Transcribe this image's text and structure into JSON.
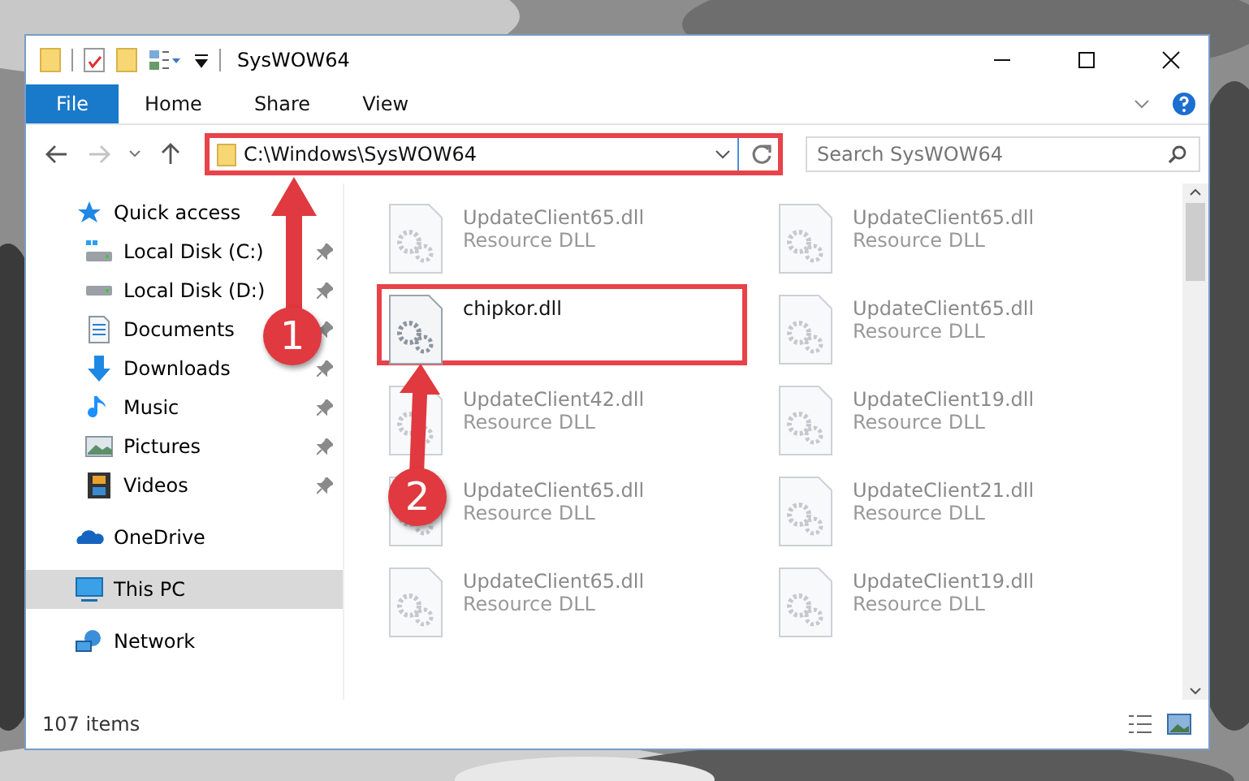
{
  "window": {
    "title": "SysWOW64"
  },
  "ribbon_tabs": [
    {
      "label": "File",
      "kind": "application"
    },
    {
      "label": "Home",
      "kind": "tab"
    },
    {
      "label": "Share",
      "kind": "tab"
    },
    {
      "label": "View",
      "kind": "tab"
    }
  ],
  "address": {
    "path": "C:\\Windows\\SysWOW64",
    "marked": true
  },
  "search": {
    "placeholder": "Search SysWOW64"
  },
  "nav_items": [
    {
      "label": "Quick access",
      "kind": "star",
      "selected": false,
      "children": [
        {
          "label": "Local Disk (C:)",
          "kind": "disk-c",
          "pinned": true,
          "selected": false
        },
        {
          "label": "Local Disk (D:)",
          "kind": "disk",
          "pinned": true,
          "selected": false
        },
        {
          "label": "Documents",
          "kind": "documents",
          "pinned": true,
          "selected": false
        },
        {
          "label": "Downloads",
          "kind": "downloads",
          "pinned": true,
          "selected": false
        },
        {
          "label": "Music",
          "kind": "music",
          "pinned": true,
          "selected": false
        },
        {
          "label": "Pictures",
          "kind": "pictures",
          "pinned": true,
          "selected": false
        },
        {
          "label": "Videos",
          "kind": "videos",
          "pinned": true,
          "selected": false
        }
      ]
    },
    {
      "label": "OneDrive",
      "kind": "cloud",
      "selected": false
    },
    {
      "label": "This PC",
      "kind": "pc",
      "selected": true
    },
    {
      "label": "Network",
      "kind": "network",
      "selected": false
    }
  ],
  "files": [
    {
      "name": "UpdateClient65.dll",
      "type": "Resource DLL",
      "blurred": true,
      "marked": false
    },
    {
      "name": "UpdateClient65.dll",
      "type": "Resource DLL",
      "blurred": true,
      "marked": false
    },
    {
      "name": "chipkor.dll",
      "blurred": false,
      "marked": true
    },
    {
      "name": "UpdateClient65.dll",
      "type": "Resource DLL",
      "blurred": true,
      "marked": false
    },
    {
      "name": "UpdateClient42.dll",
      "type": "Resource DLL",
      "blurred": true,
      "marked": false
    },
    {
      "name": "UpdateClient19.dll",
      "type": "Resource DLL",
      "blurred": true,
      "marked": false
    },
    {
      "name": "UpdateClient65.dll",
      "type": "Resource DLL",
      "blurred": true,
      "marked": false
    },
    {
      "name": "UpdateClient21.dll",
      "type": "Resource DLL",
      "blurred": true,
      "marked": false
    },
    {
      "name": "UpdateClient65.dll",
      "type": "Resource DLL",
      "blurred": true,
      "marked": false
    },
    {
      "name": "UpdateClient19.dll",
      "type": "Resource DLL",
      "blurred": true,
      "marked": false
    }
  ],
  "status_bar": {
    "item_count": "107 items"
  },
  "annotations": [
    {
      "label": "1"
    },
    {
      "label": "2"
    }
  ]
}
